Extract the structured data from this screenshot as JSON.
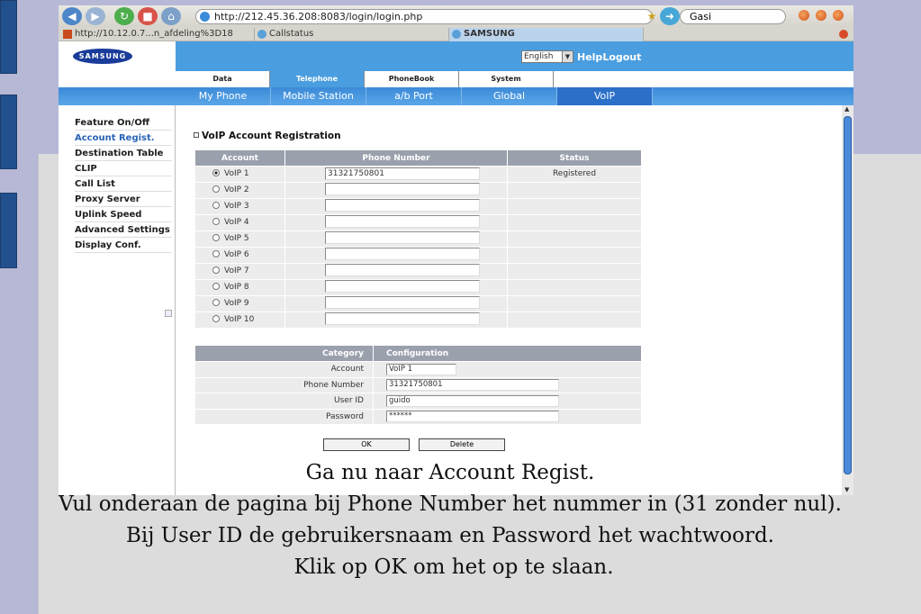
{
  "browser": {
    "url": "http://212.45.36.208:8083/login/login.php",
    "search_value": "Gasi",
    "tabs": [
      {
        "label": "http://10.12.0.7...n_afdeling%3D18"
      },
      {
        "label": "Callstatus"
      },
      {
        "label": "SAMSUNG"
      }
    ]
  },
  "header": {
    "logo": "SAMSUNG",
    "language": "English",
    "help": "Help",
    "logout": "Logout"
  },
  "main_tabs": [
    "Data",
    "Telephone",
    "PhoneBook",
    "System"
  ],
  "sub_tabs": [
    "My Phone",
    "Mobile Station",
    "a/b Port",
    "Global",
    "VoIP"
  ],
  "sidebar": {
    "items": [
      {
        "label": "Feature On/Off"
      },
      {
        "label": "Account Regist."
      },
      {
        "label": "Destination Table"
      },
      {
        "label": "CLIP"
      },
      {
        "label": "Call List"
      },
      {
        "label": "Proxy Server"
      },
      {
        "label": "Uplink Speed"
      },
      {
        "label": "Advanced Settings"
      },
      {
        "label": "Display Conf."
      }
    ]
  },
  "content": {
    "section_title": "VoIP Account Registration",
    "table_headers": {
      "account": "Account",
      "phone_number": "Phone Number",
      "status": "Status"
    },
    "accounts": [
      {
        "name": "VoIP 1",
        "phone": "31321750801",
        "status": "Registered"
      },
      {
        "name": "VoIP 2",
        "phone": "",
        "status": ""
      },
      {
        "name": "VoIP 3",
        "phone": "",
        "status": ""
      },
      {
        "name": "VoIP 4",
        "phone": "",
        "status": ""
      },
      {
        "name": "VoIP 5",
        "phone": "",
        "status": ""
      },
      {
        "name": "VoIP 6",
        "phone": "",
        "status": ""
      },
      {
        "name": "VoIP 7",
        "phone": "",
        "status": ""
      },
      {
        "name": "VoIP 8",
        "phone": "",
        "status": ""
      },
      {
        "name": "VoIP 9",
        "phone": "",
        "status": ""
      },
      {
        "name": "VoIP 10",
        "phone": "",
        "status": ""
      }
    ],
    "config_headers": {
      "category": "Category",
      "configuration": "Configuration"
    },
    "config": {
      "account_label": "Account",
      "account_value": "VoIP 1",
      "phone_label": "Phone Number",
      "phone_value": "31321750801",
      "userid_label": "User ID",
      "userid_value": "guido",
      "password_label": "Password",
      "password_value": "******"
    },
    "ok_button": "OK",
    "delete_button": "Delete"
  },
  "caption": {
    "line1": "Ga nu naar Account Regist.",
    "line2": "Vul onderaan de pagina bij Phone Number het nummer in (31 zonder nul).",
    "line3": "Bij User ID de gebruikersnaam en Password het wachtwoord.",
    "line4": "Klik op OK om het op te slaan."
  }
}
